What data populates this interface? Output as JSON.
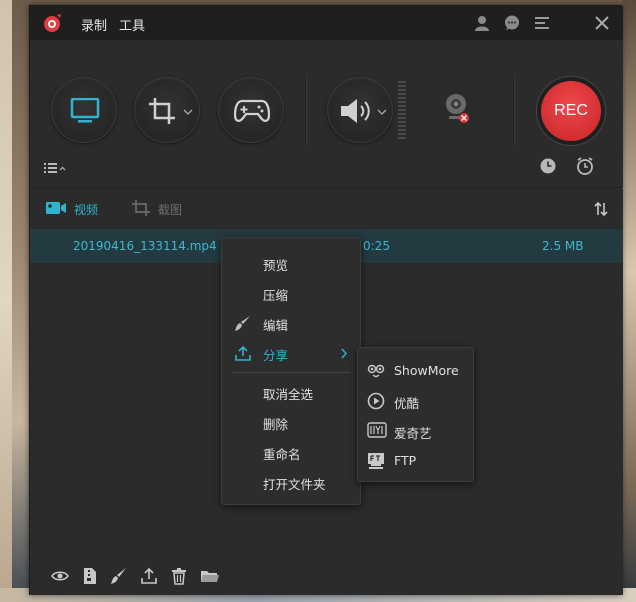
{
  "app": {
    "menus": [
      "录制",
      "工具"
    ]
  },
  "tabs": {
    "video": "视频",
    "screenshot": "截图"
  },
  "files": [
    {
      "name": "20190416_133114.mp4",
      "duration": "0:25",
      "size": "2.5 MB"
    }
  ],
  "controls": {
    "rec_label": "REC"
  },
  "context_menu": {
    "items": [
      {
        "label": "预览",
        "icon": null
      },
      {
        "label": "压缩",
        "icon": null
      },
      {
        "label": "编辑",
        "icon": "brush-icon"
      },
      {
        "label": "分享",
        "icon": "upload-icon",
        "has_submenu": true,
        "active": true
      },
      {
        "label": "取消全选",
        "icon": null
      },
      {
        "label": "删除",
        "icon": null
      },
      {
        "label": "重命名",
        "icon": null
      },
      {
        "label": "打开文件夹",
        "icon": null
      }
    ]
  },
  "share_submenu": {
    "items": [
      {
        "label": "ShowMore",
        "icon": "showmore-icon"
      },
      {
        "label": "优酷",
        "icon": "youku-icon"
      },
      {
        "label": "爱奇艺",
        "icon": "iqiyi-icon"
      },
      {
        "label": "FTP",
        "icon": "ftp-icon"
      }
    ]
  },
  "colors": {
    "accent": "#2fb3cf",
    "rec_red": "#d32f33",
    "window_bg": "#2b2b2b",
    "titlebar_bg": "#1f1f1f",
    "selected_row_bg": "#233a40"
  }
}
